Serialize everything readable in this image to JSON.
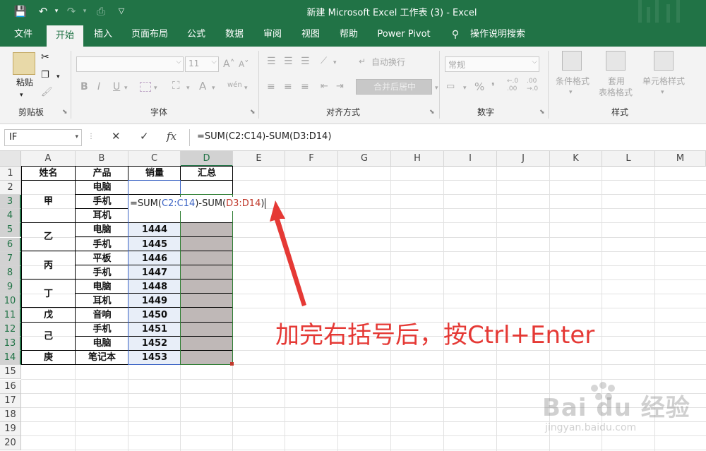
{
  "window": {
    "title": "新建 Microsoft Excel 工作表 (3)  -  Excel",
    "qat": {
      "save": "💾",
      "undo": "↶",
      "redo": "↷",
      "preview": "⎙",
      "more": "▽"
    }
  },
  "tabs": [
    {
      "label": "文件"
    },
    {
      "label": "开始"
    },
    {
      "label": "插入"
    },
    {
      "label": "页面布局"
    },
    {
      "label": "公式"
    },
    {
      "label": "数据"
    },
    {
      "label": "审阅"
    },
    {
      "label": "视图"
    },
    {
      "label": "帮助"
    },
    {
      "label": "Power Pivot"
    }
  ],
  "tell_me": {
    "icon": "lightbulb-icon",
    "label": "操作说明搜索"
  },
  "ribbon": {
    "clipboard": {
      "paste": "粘贴",
      "group": "剪贴板"
    },
    "font": {
      "group": "字体",
      "size": "11",
      "bold": "B",
      "italic": "I",
      "underline": "U",
      "grow": "A˄",
      "shrink": "A˅",
      "color": "A",
      "phonetic": "wén"
    },
    "align": {
      "group": "对齐方式",
      "wrap": "自动换行",
      "merge": "合并后居中"
    },
    "number": {
      "group": "数字",
      "format": "常规",
      "percent": "%",
      "comma": "❜",
      "inc_dec": "←.0\n.00",
      "dec_dec": ".00\n→.0"
    },
    "styles": {
      "group": "样式",
      "conditional": "条件格式",
      "table_line1": "套用",
      "table_line2": "表格格式",
      "cell_styles": "单元格样式"
    }
  },
  "formula_bar": {
    "name_box": "IF",
    "cancel": "✕",
    "enter": "✓",
    "fx": "fx",
    "content": "=SUM(C2:C14)-SUM(D3:D14)"
  },
  "columns": [
    "A",
    "B",
    "C",
    "D",
    "E",
    "F",
    "G",
    "H",
    "I",
    "J",
    "K",
    "L",
    "M"
  ],
  "rows": [
    "1",
    "2",
    "3",
    "4",
    "5",
    "6",
    "7",
    "8",
    "9",
    "10",
    "11",
    "12",
    "13",
    "14",
    "15",
    "16",
    "17",
    "18",
    "19",
    "20"
  ],
  "table": {
    "headers": [
      "姓名",
      "产品",
      "销量",
      "汇总"
    ],
    "names": [
      "甲",
      "乙",
      "丙",
      "丁",
      "戊",
      "己",
      "庚"
    ],
    "products": [
      "电脑",
      "手机",
      "耳机",
      "电脑",
      "手机",
      "平板",
      "手机",
      "电脑",
      "耳机",
      "音响",
      "手机",
      "电脑",
      "笔记本"
    ],
    "sales": [
      "1444",
      "1445",
      "1446",
      "1447",
      "1448",
      "1449",
      "1450",
      "1451",
      "1452",
      "1453"
    ]
  },
  "editing_formula": {
    "prefix": "=SUM(",
    "ref1": "C2:C14",
    "mid": ")-SUM(",
    "ref2": "D3:D14",
    "suffix": ")"
  },
  "annotation": "加完右括号后，按Ctrl+Enter",
  "watermark": {
    "brand": "Bai du 经验",
    "url": "jingyan.baidu.com"
  },
  "colors": {
    "excel_green": "#217346",
    "annotation_red": "#e53935",
    "selected_fill": "#bfb8b7"
  }
}
